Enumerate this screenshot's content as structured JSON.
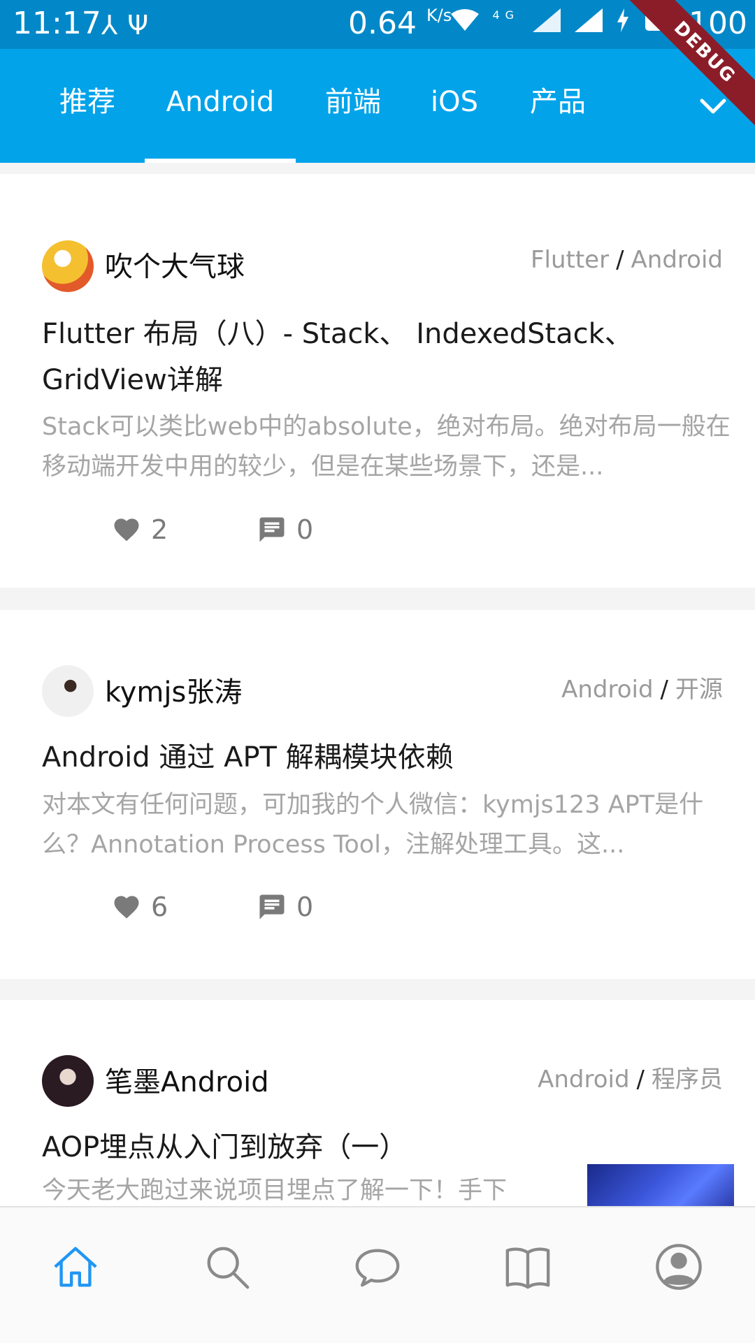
{
  "status_bar": {
    "time": "11:17",
    "speed": "0.64",
    "speed_unit": "K/s",
    "network": "4G",
    "battery": "100",
    "debug_label": "DEBUG"
  },
  "tabs": [
    {
      "label": "推荐",
      "active": false
    },
    {
      "label": "Android",
      "active": true
    },
    {
      "label": "前端",
      "active": false
    },
    {
      "label": "iOS",
      "active": false
    },
    {
      "label": "产品",
      "active": false
    }
  ],
  "articles": [
    {
      "author": "吹个大气球",
      "tag1": "Flutter",
      "tag2": "Android",
      "title": "Flutter 布局（八）- Stack、 IndexedStack、GridView详解",
      "summary": "Stack可以类比web中的absolute，绝对布局。绝对布局一般在移动端开发中用的较少，但是在某些场景下，还是...",
      "likes": "2",
      "comments": "0"
    },
    {
      "author": "kymjs张涛",
      "tag1": "Android",
      "tag2": "开源",
      "title": "Android 通过 APT 解耦模块依赖",
      "summary": "对本文有任何问题，可加我的个人微信：kymjs123 APT是什么？Annotation Process Tool，注解处理工具。这...",
      "likes": "6",
      "comments": "0"
    },
    {
      "author": "笔墨Android",
      "tag1": "Android",
      "tag2": "程序员",
      "title": "AOP埋点从入门到放弃（一）",
      "summary": "今天老大跑过来说项目埋点了解一下！手下"
    }
  ],
  "colors": {
    "tab_bar": "#03a3ea",
    "status_bar": "#0288c8",
    "nav_active": "#2196f3",
    "nav_inactive": "#8a8a8a"
  },
  "bottom_nav": [
    {
      "icon": "home-icon",
      "active": true
    },
    {
      "icon": "search-icon",
      "active": false
    },
    {
      "icon": "message-icon",
      "active": false
    },
    {
      "icon": "book-icon",
      "active": false
    },
    {
      "icon": "profile-icon",
      "active": false
    }
  ]
}
